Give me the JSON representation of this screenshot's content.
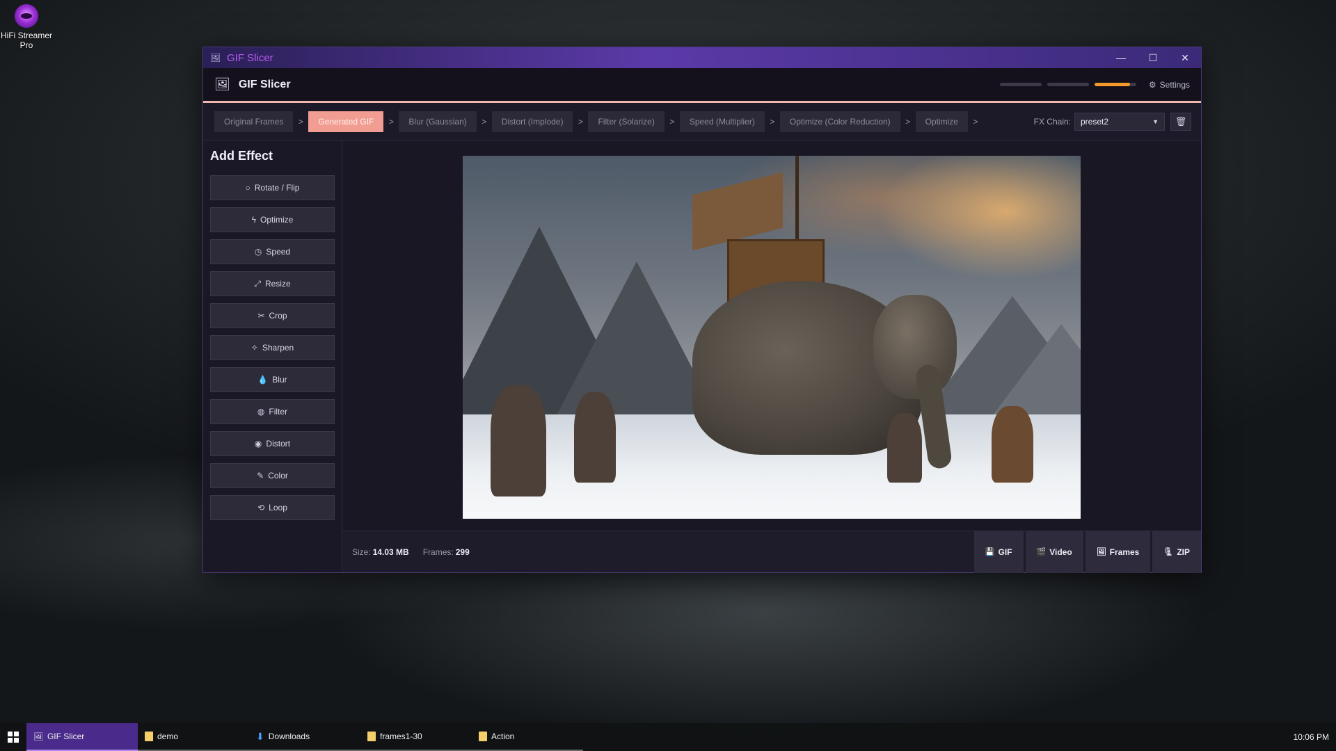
{
  "desktop": {
    "icon_label": "HiFi Streamer Pro"
  },
  "window": {
    "title": "GIF Slicer",
    "controls": {
      "minimize": "—",
      "maximize": "☐",
      "close": "✕"
    }
  },
  "app": {
    "title": "GIF Slicer",
    "progress": [
      0.0,
      0.0,
      0.85
    ],
    "settings_label": "Settings"
  },
  "pipeline": {
    "steps": [
      {
        "label": "Original Frames",
        "active": false
      },
      {
        "label": "Generated GIF",
        "active": true
      },
      {
        "label": "Blur (Gaussian)",
        "active": false
      },
      {
        "label": "Distort (Implode)",
        "active": false
      },
      {
        "label": "Filter (Solarize)",
        "active": false
      },
      {
        "label": "Speed (Multiplier)",
        "active": false
      },
      {
        "label": "Optimize (Color Reduction)",
        "active": false
      },
      {
        "label": "Optimize",
        "active": false
      }
    ],
    "separator": ">",
    "fx_chain_label": "FX Chain:",
    "fx_chain_value": "preset2"
  },
  "sidebar": {
    "title": "Add Effect",
    "buttons": [
      {
        "label": "Rotate / Flip",
        "icon": "rotate-icon",
        "glyph": "○"
      },
      {
        "label": "Optimize",
        "icon": "bolt-icon",
        "glyph": "ϟ"
      },
      {
        "label": "Speed",
        "icon": "stopwatch-icon",
        "glyph": "◷"
      },
      {
        "label": "Resize",
        "icon": "resize-icon",
        "glyph": "⤢"
      },
      {
        "label": "Crop",
        "icon": "crop-icon",
        "glyph": "✂"
      },
      {
        "label": "Sharpen",
        "icon": "sharpen-icon",
        "glyph": "✧"
      },
      {
        "label": "Blur",
        "icon": "droplet-icon",
        "glyph": "💧"
      },
      {
        "label": "Filter",
        "icon": "palette-icon",
        "glyph": "◍"
      },
      {
        "label": "Distort",
        "icon": "distort-icon",
        "glyph": "◉"
      },
      {
        "label": "Color",
        "icon": "brush-icon",
        "glyph": "✎"
      },
      {
        "label": "Loop",
        "icon": "loop-icon",
        "glyph": "⟲"
      }
    ]
  },
  "footer": {
    "size_label": "Size:",
    "size_value": "14.03 MB",
    "frames_label": "Frames:",
    "frames_value": "299",
    "exports": [
      {
        "label": "GIF",
        "icon": "save-icon"
      },
      {
        "label": "Video",
        "icon": "video-icon"
      },
      {
        "label": "Frames",
        "icon": "image-icon"
      },
      {
        "label": "ZIP",
        "icon": "archive-icon"
      }
    ]
  },
  "taskbar": {
    "items": [
      {
        "label": "GIF Slicer",
        "active": true,
        "icon": "app-icon"
      },
      {
        "label": "demo",
        "active": false,
        "icon": "folder-icon"
      },
      {
        "label": "Downloads",
        "active": false,
        "icon": "download-icon"
      },
      {
        "label": "frames1-30",
        "active": false,
        "icon": "folder-icon"
      },
      {
        "label": "Action",
        "active": false,
        "icon": "folder-icon"
      }
    ],
    "clock": "10:06 PM"
  }
}
